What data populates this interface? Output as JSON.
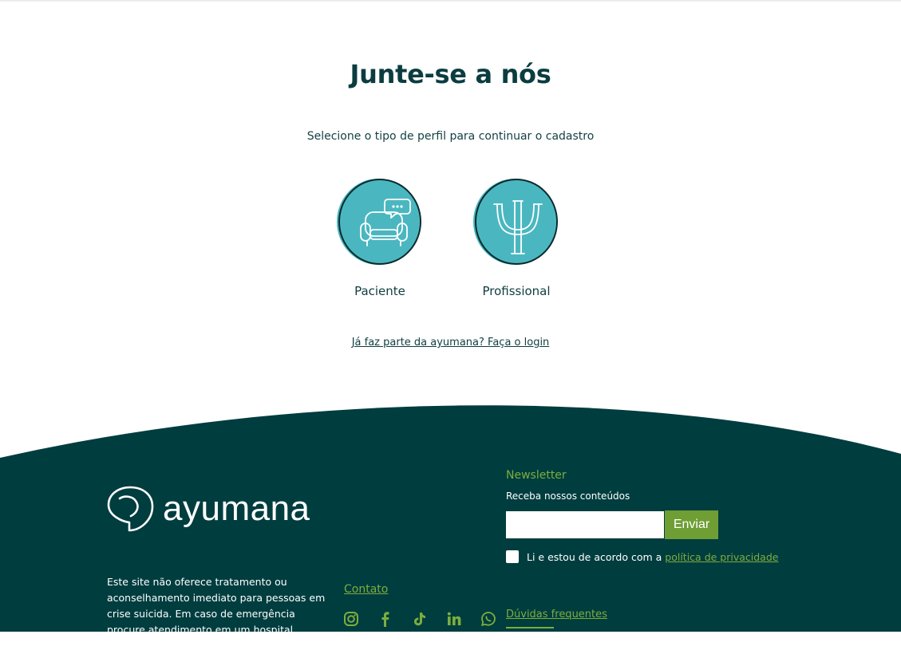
{
  "main": {
    "title": "Junte-se a nós",
    "subtitle": "Selecione o tipo de perfil para continuar o cadastro",
    "profiles": [
      {
        "label": "Paciente",
        "icon": "sofa-chat-icon"
      },
      {
        "label": "Profissional",
        "icon": "psi-icon"
      }
    ],
    "login_link": "Já faz parte da ayumana? Faça o login"
  },
  "footer": {
    "brand": "ayumana",
    "disclaimer": "Este site não oferece tratamento ou aconselhamento imediato para pessoas em crise suicida. Em caso de emergência procure atendimento em um hospital próximo.",
    "contact_label": "Contato",
    "socials": [
      "instagram-icon",
      "facebook-icon",
      "tiktok-icon",
      "linkedin-icon",
      "whatsapp-icon"
    ],
    "newsletter": {
      "title": "Newsletter",
      "subtitle": "Receba nossos conteúdos",
      "input_value": "",
      "button": "Enviar",
      "consent_prefix": "Li e estou de acordo com a ",
      "consent_link": "política de privacidade"
    },
    "faq_link": "Dúvidas frequentes"
  },
  "colors": {
    "primary_dark": "#003d3f",
    "accent_green": "#7cae3c",
    "button_green": "#6f9e34",
    "icon_teal": "#4ab7c0"
  }
}
